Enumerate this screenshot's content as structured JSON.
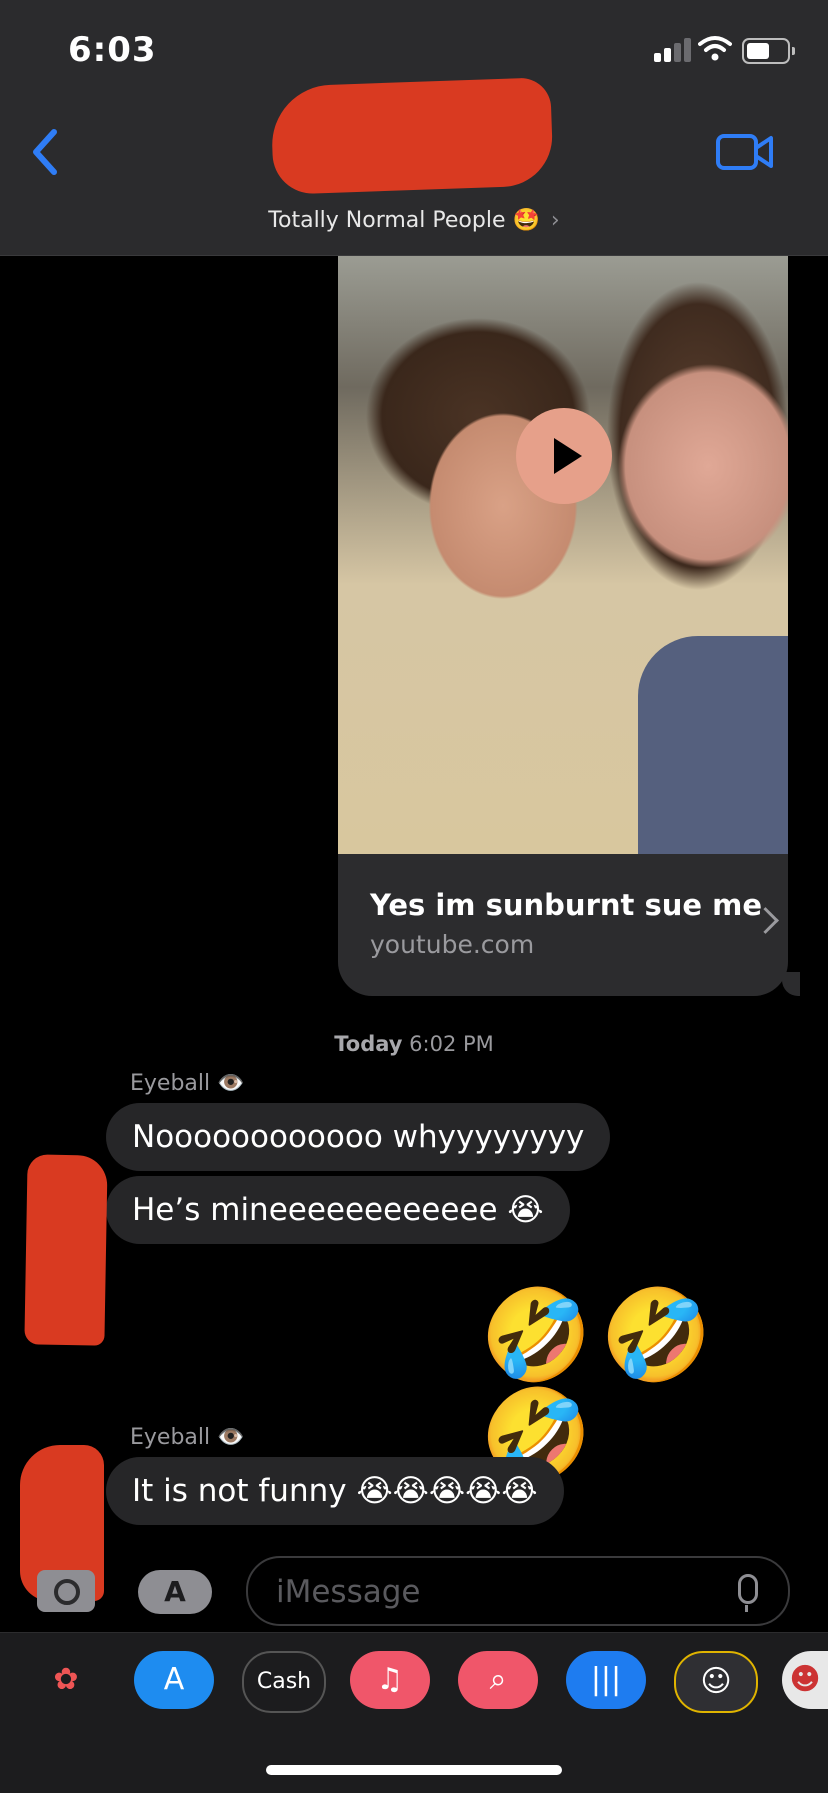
{
  "status_bar": {
    "time": "6:03"
  },
  "header": {
    "group_name": "Totally Normal People 🤩",
    "chevron": "›",
    "back_icon": "chevron-left-icon",
    "video_icon": "video-camera-icon",
    "accent_color": "#2f7df6"
  },
  "link_preview": {
    "title": "Yes im sunburnt sue me",
    "source": "youtube.com"
  },
  "timestamp": {
    "day": "Today",
    "time": "6:02 PM"
  },
  "messages": [
    {
      "sender": "Eyeball 👁️",
      "text": "Noooooooooooo whyyyyyyyy"
    },
    {
      "text": "He’s mineeeeeeeeeeee 😭"
    },
    {
      "outgoing_emoji": "🤣🤣🤣"
    },
    {
      "sender": "Eyeball 👁️",
      "text": "It is not funny 😭😭😭😭😭"
    }
  ],
  "input": {
    "placeholder": "iMessage",
    "apps_glyph": "A"
  },
  "app_drawer": [
    {
      "name": "photos",
      "label": "✿",
      "color": "#ffffff"
    },
    {
      "name": "app-store",
      "label": "A",
      "color": "#1e8cf0"
    },
    {
      "name": "apple-cash",
      "label": "Cash",
      "color": "#1c1c1e"
    },
    {
      "name": "music",
      "label": "♫",
      "color": "#f0566a"
    },
    {
      "name": "images-search",
      "label": "⌕",
      "color": "#f0566a"
    },
    {
      "name": "audio",
      "label": "|||",
      "color": "#1e7cf0"
    },
    {
      "name": "memoji",
      "label": "☺",
      "color": "#2f2f33"
    },
    {
      "name": "stickers",
      "label": "☻",
      "color": "#e8e8e8"
    }
  ]
}
